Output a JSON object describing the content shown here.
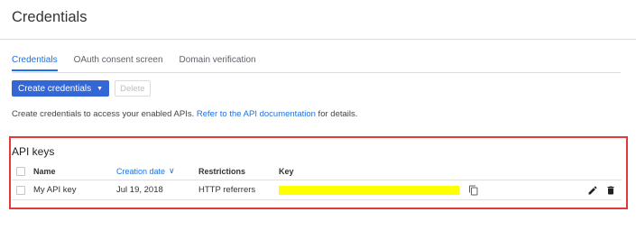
{
  "page": {
    "title": "Credentials"
  },
  "tabs": [
    {
      "label": "Credentials",
      "active": true
    },
    {
      "label": "OAuth consent screen",
      "active": false
    },
    {
      "label": "Domain verification",
      "active": false
    }
  ],
  "toolbar": {
    "create_label": "Create credentials",
    "create_caret": "▼",
    "delete_label": "Delete"
  },
  "description": {
    "prefix": "Create credentials to access your enabled APIs. ",
    "link": "Refer to the API documentation",
    "suffix": " for details."
  },
  "api_keys": {
    "section_title": "API keys",
    "columns": {
      "name": "Name",
      "creation_date": "Creation date",
      "sort_indicator": "∨",
      "restrictions": "Restrictions",
      "key": "Key"
    },
    "rows": [
      {
        "name": "My API key",
        "creation_date": "Jul 19, 2018",
        "restrictions": "HTTP referrers"
      }
    ]
  },
  "colors": {
    "accent": "#1a73e8",
    "primary_button": "#3367d6",
    "highlight_border": "#e53935",
    "key_redaction": "#ffff00"
  },
  "icons": [
    "copy-icon",
    "edit-icon",
    "delete-icon",
    "dropdown-caret-icon",
    "sort-arrow-icon"
  ]
}
